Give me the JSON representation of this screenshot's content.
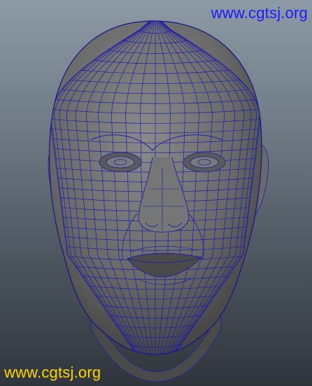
{
  "viewport": {
    "background_top": "#8d9aa6",
    "background_bottom": "#2f353b",
    "mesh_color": "#1c1caa",
    "surface_color": "#6a6a6a",
    "object": "head-mesh"
  },
  "watermarks": {
    "top_right": {
      "text": "www.cgtsj.org",
      "color": "#1a1aff"
    },
    "bottom_left": {
      "text": "www.cgtsj.org",
      "color": "#ffd400"
    }
  }
}
